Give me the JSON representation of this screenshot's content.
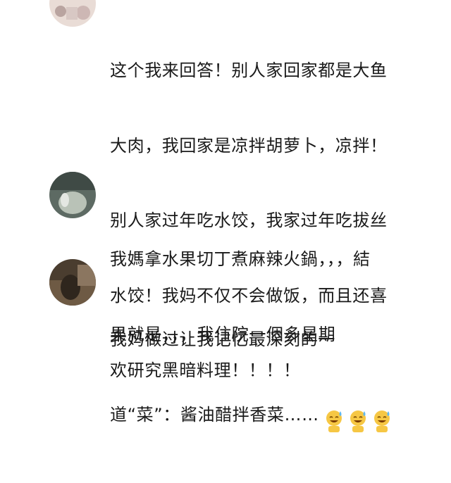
{
  "comments": [
    {
      "lines": [
        "这个我来回答！别人家回家都是大鱼",
        "大肉，我回家是凉拌胡萝卜，凉拌！",
        "别人家过年吃水饺，我家过年吃拔丝",
        "水饺！我妈不仅不会做饭，而且还喜",
        "欢研究黑暗料理！！！！"
      ]
    },
    {
      "lines": [
        "我媽拿水果切丁煮麻辣火鍋，，，結",
        "果就是，，，我住院一個多星期"
      ]
    },
    {
      "lines": [
        "我妈做过让我记忆最深刻的一",
        "道“菜”：酱油醋拌香菜……"
      ],
      "emojis": [
        "sweat-smile-emoji",
        "sweat-smile-emoji",
        "sweat-smile-emoji"
      ]
    }
  ]
}
